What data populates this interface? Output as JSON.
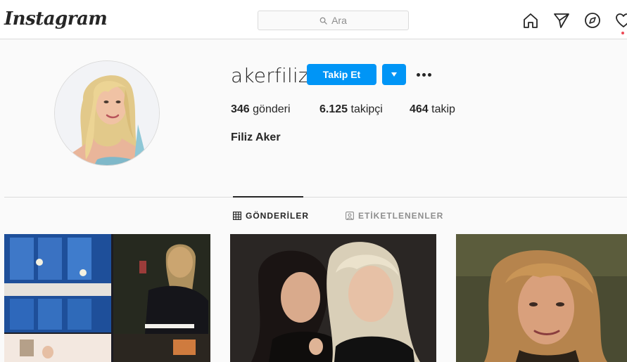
{
  "nav": {
    "logo": "Instagram",
    "search_placeholder": "Ara",
    "icons": [
      "home-icon",
      "direct-icon",
      "explore-icon",
      "activity-icon"
    ]
  },
  "profile": {
    "username": "akerfiliz",
    "follow_label": "Takip Et",
    "stats": [
      {
        "count": "346",
        "label": "gönderi"
      },
      {
        "count": "6.125",
        "label": "takipçi"
      },
      {
        "count": "464",
        "label": "takip"
      }
    ],
    "full_name": "Filiz Aker"
  },
  "tabs": [
    {
      "label": "GÖNDERİLER",
      "active": true
    },
    {
      "label": "ETİKETLENENLER",
      "active": false
    }
  ],
  "colors": {
    "accent": "#0095f6",
    "notification": "#ed4956",
    "text": "#262626",
    "muted": "#8e8e8e",
    "border": "#dbdbdb"
  }
}
